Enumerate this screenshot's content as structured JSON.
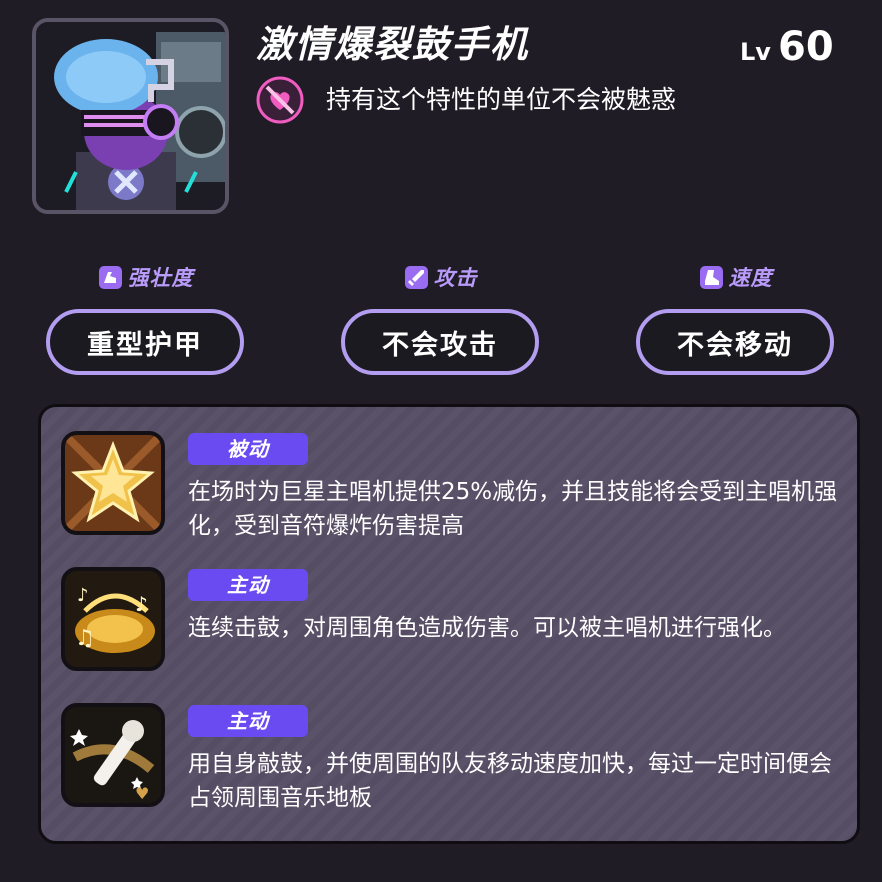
{
  "unit": {
    "name": "激情爆裂鼓手机",
    "level_prefix": "Lv",
    "level": "60",
    "portrait_icon": "drummer-robot-portrait"
  },
  "trait": {
    "icon": "no-charm-icon",
    "text": "持有这个特性的单位不会被魅惑"
  },
  "stats": [
    {
      "label": "强壮度",
      "icon": "arm-icon",
      "value": "重型护甲"
    },
    {
      "label": "攻击",
      "icon": "sword-icon",
      "value": "不会攻击"
    },
    {
      "label": "速度",
      "icon": "boot-icon",
      "value": "不会移动"
    }
  ],
  "skills": [
    {
      "type": "被动",
      "icon": "star-icon",
      "description": "在场时为巨星主唱机提供25%减伤，并且技能将会受到主唱机强化，受到音符爆炸伤害提高"
    },
    {
      "type": "主动",
      "icon": "music-swirl-icon",
      "description": "连续击鼓，对周围角色造成伤害。可以被主唱机进行强化。"
    },
    {
      "type": "主动",
      "icon": "microphone-icon",
      "description": "用自身敲鼓，并使周围的队友移动速度加快，每过一定时间便会占领周围音乐地板"
    }
  ],
  "colors": {
    "background": "#1f1c25",
    "accent_purple": "#6a4bf2",
    "stat_label": "#b99bfb",
    "pill_border": "#b29df0",
    "panel": "#5a5268"
  }
}
